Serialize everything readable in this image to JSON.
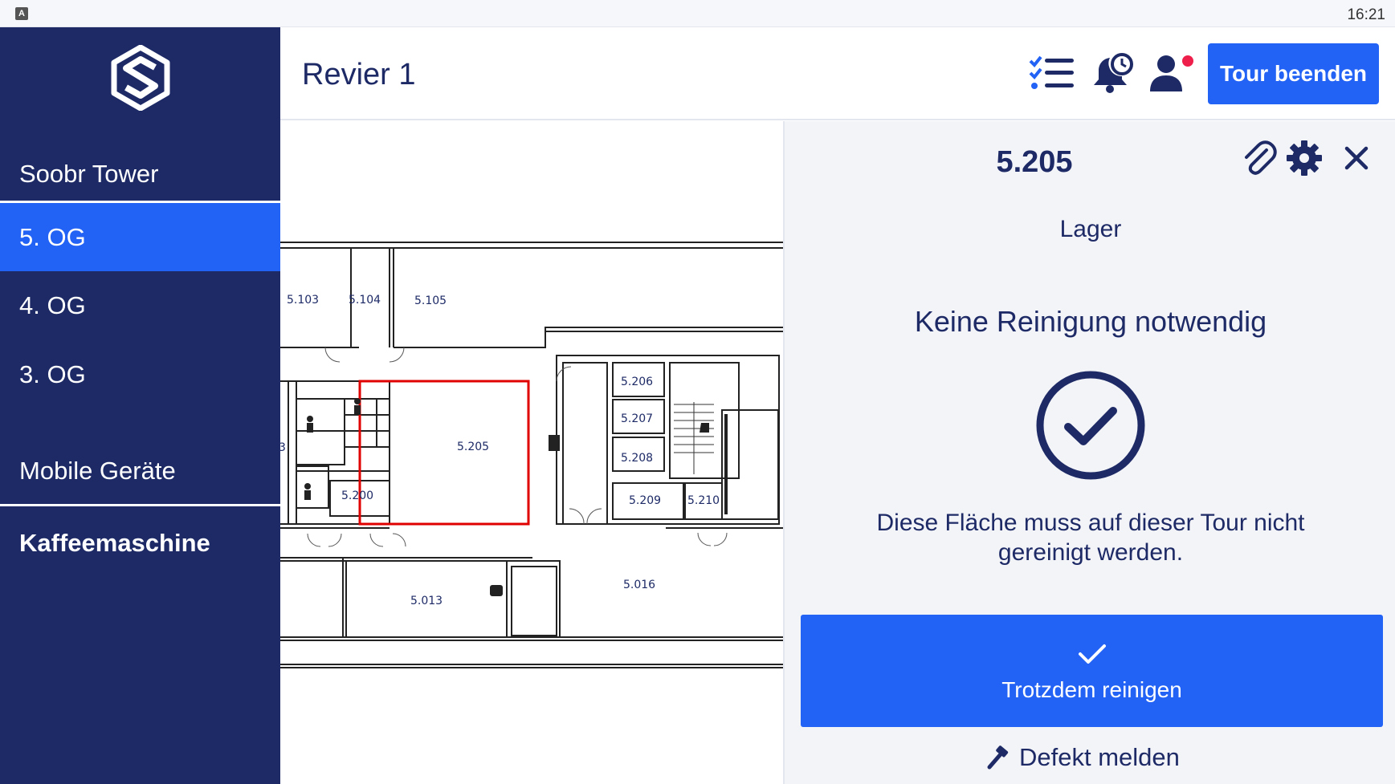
{
  "statusbar": {
    "app_badge": "A",
    "time": "16:21"
  },
  "sidebar": {
    "logo_icon": "soobr-logo-icon",
    "building": "Soobr Tower",
    "floors": [
      {
        "label": "5. OG",
        "active": true
      },
      {
        "label": "4. OG",
        "active": false
      },
      {
        "label": "3. OG",
        "active": false
      }
    ],
    "devices_heading": "Mobile Geräte",
    "devices": [
      {
        "label": "Kaffeemaschine"
      }
    ]
  },
  "header": {
    "title": "Revier 1",
    "icons": [
      "checklist-icon",
      "bell-clock-icon",
      "user-notification-icon"
    ],
    "end_tour_label": "Tour beenden"
  },
  "map": {
    "rooms": [
      "5.103",
      "5.104",
      "5.105",
      "5.205",
      "5.206",
      "5.207",
      "5.208",
      "5.209",
      "5.210",
      "5.200",
      "5.013",
      "5.016",
      "3"
    ],
    "selected_room": "5.205",
    "colors": {
      "selected_outline": "#e00000",
      "walls": "#222222"
    }
  },
  "panel": {
    "room_number": "5.205",
    "icons": [
      "paperclip-icon",
      "gear-icon",
      "close-icon"
    ],
    "room_type": "Lager",
    "status_title": "Keine Reinigung notwendig",
    "status_icon": "check-circle-icon",
    "status_description": "Diese Fläche muss auf dieser Tour nicht gereinigt werden.",
    "clean_anyway_label": "Trotzdem reinigen",
    "report_defect_label": "Defekt melden"
  },
  "colors": {
    "sidebar": "#1d2a66",
    "accent": "#2262f5",
    "notification_dot": "#ef1f4b",
    "panel_bg": "#f3f4f8"
  }
}
